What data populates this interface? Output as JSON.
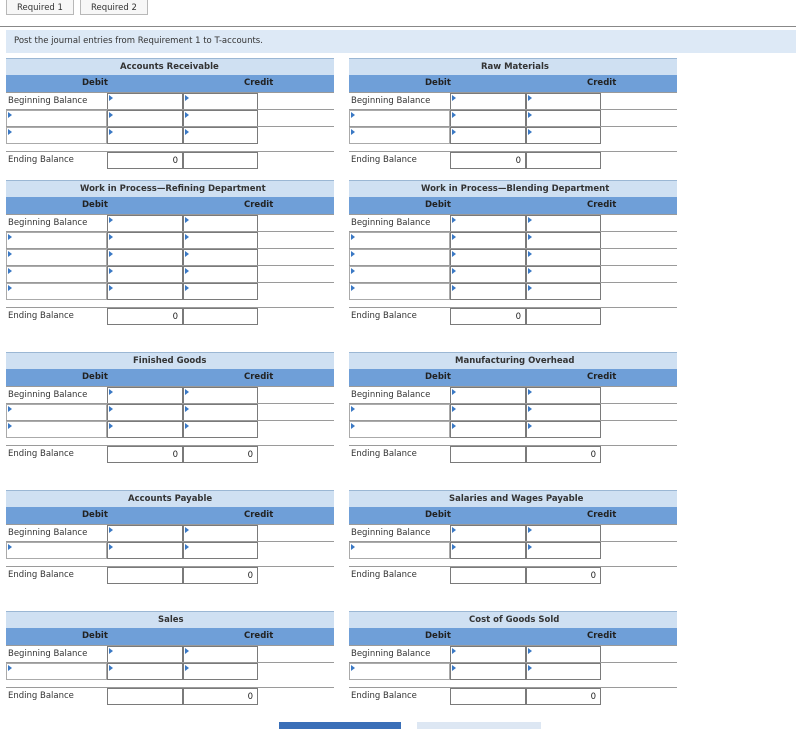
{
  "tabs": [
    "Required 1",
    "Required 2"
  ],
  "instruction": "Post the journal entries from Requirement 1 to T-accounts.",
  "labels": {
    "debit": "Debit",
    "credit": "Credit",
    "beginning": "Beginning Balance",
    "ending": "Ending Balance"
  },
  "accounts": [
    {
      "name": "Accounts Receivable",
      "ending_debit": "0",
      "ending_credit": ""
    },
    {
      "name": "Raw Materials",
      "ending_debit": "0",
      "ending_credit": ""
    },
    {
      "name": "Work in Process—Refining Department",
      "ending_debit": "0",
      "ending_credit": ""
    },
    {
      "name": "Work in Process—Blending Department",
      "ending_debit": "0",
      "ending_credit": ""
    },
    {
      "name": "Finished Goods",
      "ending_debit": "0",
      "ending_credit": "0"
    },
    {
      "name": "Manufacturing Overhead",
      "ending_debit": "",
      "ending_credit": "0"
    },
    {
      "name": "Accounts Payable",
      "ending_debit": "",
      "ending_credit": "0"
    },
    {
      "name": "Salaries and Wages Payable",
      "ending_debit": "",
      "ending_credit": "0"
    },
    {
      "name": "Sales",
      "ending_debit": "",
      "ending_credit": "0"
    },
    {
      "name": "Cost of Goods Sold",
      "ending_debit": "",
      "ending_credit": "0"
    }
  ],
  "colors": {
    "header_blue": "#6f9fd8",
    "title_bg": "#cfe0f2",
    "instruction_bg": "#dde9f6",
    "arrow": "#3a78c4"
  }
}
